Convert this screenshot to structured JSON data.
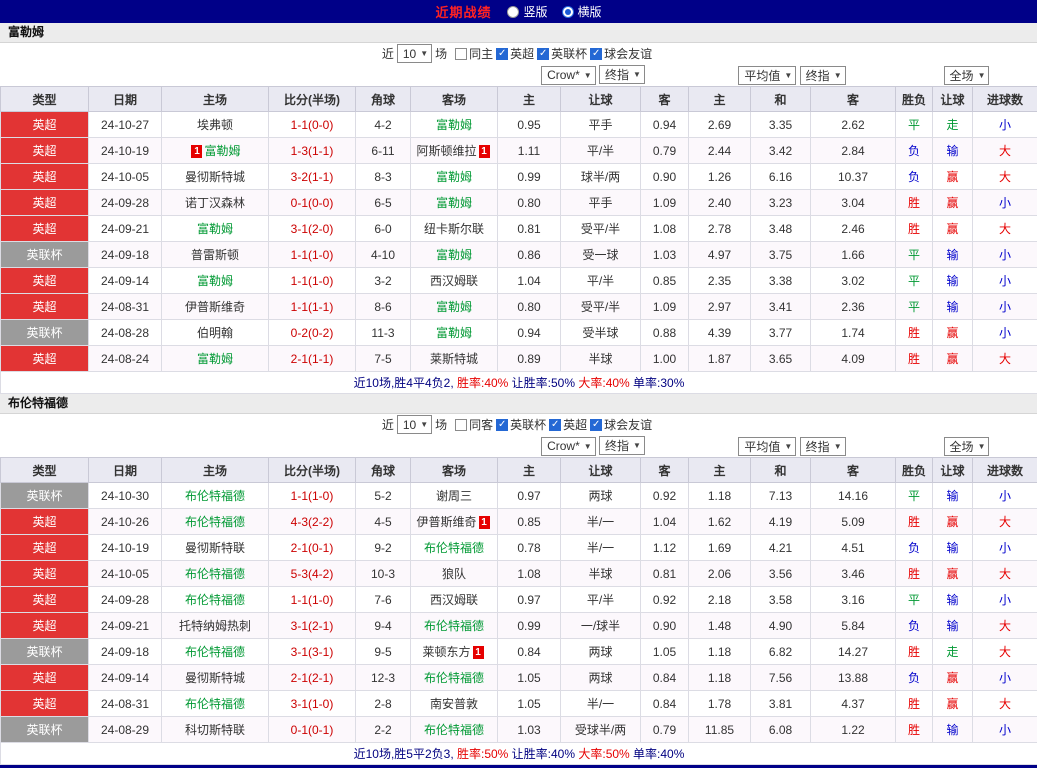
{
  "top_bar": {
    "title": "近期战绩",
    "radios": [
      {
        "label": "竖版",
        "checked": false
      },
      {
        "label": "横版",
        "checked": true
      }
    ]
  },
  "colors": {
    "navy": "#000088",
    "league_red": "#e23434",
    "league_gray": "#9b9b9b",
    "team_green": "#009933",
    "score_red": "#cc0000",
    "win_red": "#e60000",
    "draw_green": "#009933",
    "lose_blue": "#0000cc"
  },
  "sections": [
    {
      "team": "富勒姆",
      "filter": {
        "near_label": "近",
        "count": "10",
        "games_label": "场",
        "checkboxes": [
          {
            "label": "同主",
            "checked": false
          },
          {
            "label": "英超",
            "checked": true
          },
          {
            "label": "英联杯",
            "checked": true
          },
          {
            "label": "球会友谊",
            "checked": true
          }
        ]
      },
      "controls": {
        "odds_company": "Crow*",
        "odds_final": "终指",
        "average": "平均值",
        "average_final": "终指",
        "scope": "全场"
      },
      "headers": [
        "类型",
        "日期",
        "主场",
        "比分(半场)",
        "角球",
        "客场",
        "主",
        "让球",
        "客",
        "主",
        "和",
        "客",
        "胜负",
        "让球",
        "进球数"
      ],
      "rows": [
        {
          "league": "英超",
          "league_color": "red",
          "date": "24-10-27",
          "home": "埃弗顿",
          "home_is_subject": false,
          "home_card": "",
          "score": "1-1(0-0)",
          "corners": "4-2",
          "away": "富勒姆",
          "away_is_subject": true,
          "away_card": "",
          "odds_home": "0.95",
          "handicap": "平手",
          "odds_away": "0.94",
          "avg_home": "2.69",
          "avg_draw": "3.35",
          "avg_away": "2.62",
          "result": "平",
          "result_color": "green",
          "handicap_result": "走",
          "handicap_result_color": "green",
          "goals": "小",
          "goals_color": "blue"
        },
        {
          "league": "英超",
          "league_color": "red",
          "date": "24-10-19",
          "home": "富勒姆",
          "home_is_subject": true,
          "home_card": "before",
          "score": "1-3(1-1)",
          "corners": "6-11",
          "away": "阿斯顿维拉",
          "away_is_subject": false,
          "away_card": "after",
          "odds_home": "1.11",
          "handicap": "平/半",
          "odds_away": "0.79",
          "avg_home": "2.44",
          "avg_draw": "3.42",
          "avg_away": "2.84",
          "result": "负",
          "result_color": "blue",
          "handicap_result": "输",
          "handicap_result_color": "blue",
          "goals": "大",
          "goals_color": "red"
        },
        {
          "league": "英超",
          "league_color": "red",
          "date": "24-10-05",
          "home": "曼彻斯特城",
          "home_is_subject": false,
          "home_card": "",
          "score": "3-2(1-1)",
          "corners": "8-3",
          "away": "富勒姆",
          "away_is_subject": true,
          "away_card": "",
          "odds_home": "0.99",
          "handicap": "球半/两",
          "odds_away": "0.90",
          "avg_home": "1.26",
          "avg_draw": "6.16",
          "avg_away": "10.37",
          "result": "负",
          "result_color": "blue",
          "handicap_result": "赢",
          "handicap_result_color": "red",
          "goals": "大",
          "goals_color": "red"
        },
        {
          "league": "英超",
          "league_color": "red",
          "date": "24-09-28",
          "home": "诺丁汉森林",
          "home_is_subject": false,
          "home_card": "",
          "score": "0-1(0-0)",
          "corners": "6-5",
          "away": "富勒姆",
          "away_is_subject": true,
          "away_card": "",
          "odds_home": "0.80",
          "handicap": "平手",
          "odds_away": "1.09",
          "avg_home": "2.40",
          "avg_draw": "3.23",
          "avg_away": "3.04",
          "result": "胜",
          "result_color": "red",
          "handicap_result": "赢",
          "handicap_result_color": "red",
          "goals": "小",
          "goals_color": "blue"
        },
        {
          "league": "英超",
          "league_color": "red",
          "date": "24-09-21",
          "home": "富勒姆",
          "home_is_subject": true,
          "home_card": "",
          "score": "3-1(2-0)",
          "corners": "6-0",
          "away": "纽卡斯尔联",
          "away_is_subject": false,
          "away_card": "",
          "odds_home": "0.81",
          "handicap": "受平/半",
          "odds_away": "1.08",
          "avg_home": "2.78",
          "avg_draw": "3.48",
          "avg_away": "2.46",
          "result": "胜",
          "result_color": "red",
          "handicap_result": "赢",
          "handicap_result_color": "red",
          "goals": "大",
          "goals_color": "red"
        },
        {
          "league": "英联杯",
          "league_color": "gray",
          "date": "24-09-18",
          "home": "普雷斯顿",
          "home_is_subject": false,
          "home_card": "",
          "score": "1-1(1-0)",
          "corners": "4-10",
          "away": "富勒姆",
          "away_is_subject": true,
          "away_card": "",
          "odds_home": "0.86",
          "handicap": "受一球",
          "odds_away": "1.03",
          "avg_home": "4.97",
          "avg_draw": "3.75",
          "avg_away": "1.66",
          "result": "平",
          "result_color": "green",
          "handicap_result": "输",
          "handicap_result_color": "blue",
          "goals": "小",
          "goals_color": "blue"
        },
        {
          "league": "英超",
          "league_color": "red",
          "date": "24-09-14",
          "home": "富勒姆",
          "home_is_subject": true,
          "home_card": "",
          "score": "1-1(1-0)",
          "corners": "3-2",
          "away": "西汉姆联",
          "away_is_subject": false,
          "away_card": "",
          "odds_home": "1.04",
          "handicap": "平/半",
          "odds_away": "0.85",
          "avg_home": "2.35",
          "avg_draw": "3.38",
          "avg_away": "3.02",
          "result": "平",
          "result_color": "green",
          "handicap_result": "输",
          "handicap_result_color": "blue",
          "goals": "小",
          "goals_color": "blue"
        },
        {
          "league": "英超",
          "league_color": "red",
          "date": "24-08-31",
          "home": "伊普斯维奇",
          "home_is_subject": false,
          "home_card": "",
          "score": "1-1(1-1)",
          "corners": "8-6",
          "away": "富勒姆",
          "away_is_subject": true,
          "away_card": "",
          "odds_home": "0.80",
          "handicap": "受平/半",
          "odds_away": "1.09",
          "avg_home": "2.97",
          "avg_draw": "3.41",
          "avg_away": "2.36",
          "result": "平",
          "result_color": "green",
          "handicap_result": "输",
          "handicap_result_color": "blue",
          "goals": "小",
          "goals_color": "blue"
        },
        {
          "league": "英联杯",
          "league_color": "gray",
          "date": "24-08-28",
          "home": "伯明翰",
          "home_is_subject": false,
          "home_card": "",
          "score": "0-2(0-2)",
          "corners": "11-3",
          "away": "富勒姆",
          "away_is_subject": true,
          "away_card": "",
          "odds_home": "0.94",
          "handicap": "受半球",
          "odds_away": "0.88",
          "avg_home": "4.39",
          "avg_draw": "3.77",
          "avg_away": "1.74",
          "result": "胜",
          "result_color": "red",
          "handicap_result": "赢",
          "handicap_result_color": "red",
          "goals": "小",
          "goals_color": "blue"
        },
        {
          "league": "英超",
          "league_color": "red",
          "date": "24-08-24",
          "home": "富勒姆",
          "home_is_subject": true,
          "home_card": "",
          "score": "2-1(1-1)",
          "corners": "7-5",
          "away": "莱斯特城",
          "away_is_subject": false,
          "away_card": "",
          "odds_home": "0.89",
          "handicap": "半球",
          "odds_away": "1.00",
          "avg_home": "1.87",
          "avg_draw": "3.65",
          "avg_away": "4.09",
          "result": "胜",
          "result_color": "red",
          "handicap_result": "赢",
          "handicap_result_color": "red",
          "goals": "大",
          "goals_color": "red"
        }
      ],
      "summary": [
        {
          "text": "近10场,胜4平4负2, ",
          "color": "navy"
        },
        {
          "text": "胜率:40%",
          "color": "red"
        },
        {
          "text": " 让胜率:50%",
          "color": "navy"
        },
        {
          "text": " 大率:40%",
          "color": "red"
        },
        {
          "text": " 单率:30%",
          "color": "navy"
        }
      ]
    },
    {
      "team": "布伦特福德",
      "filter": {
        "near_label": "近",
        "count": "10",
        "games_label": "场",
        "checkboxes": [
          {
            "label": "同客",
            "checked": false
          },
          {
            "label": "英联杯",
            "checked": true
          },
          {
            "label": "英超",
            "checked": true
          },
          {
            "label": "球会友谊",
            "checked": true
          }
        ]
      },
      "controls": {
        "odds_company": "Crow*",
        "odds_final": "终指",
        "average": "平均值",
        "average_final": "终指",
        "scope": "全场"
      },
      "headers": [
        "类型",
        "日期",
        "主场",
        "比分(半场)",
        "角球",
        "客场",
        "主",
        "让球",
        "客",
        "主",
        "和",
        "客",
        "胜负",
        "让球",
        "进球数"
      ],
      "rows": [
        {
          "league": "英联杯",
          "league_color": "gray",
          "date": "24-10-30",
          "home": "布伦特福德",
          "home_is_subject": true,
          "home_card": "",
          "score": "1-1(1-0)",
          "corners": "5-2",
          "away": "谢周三",
          "away_is_subject": false,
          "away_card": "",
          "odds_home": "0.97",
          "handicap": "两球",
          "odds_away": "0.92",
          "avg_home": "1.18",
          "avg_draw": "7.13",
          "avg_away": "14.16",
          "result": "平",
          "result_color": "green",
          "handicap_result": "输",
          "handicap_result_color": "blue",
          "goals": "小",
          "goals_color": "blue"
        },
        {
          "league": "英超",
          "league_color": "red",
          "date": "24-10-26",
          "home": "布伦特福德",
          "home_is_subject": true,
          "home_card": "",
          "score": "4-3(2-2)",
          "corners": "4-5",
          "away": "伊普斯维奇",
          "away_is_subject": false,
          "away_card": "after",
          "odds_home": "0.85",
          "handicap": "半/一",
          "odds_away": "1.04",
          "avg_home": "1.62",
          "avg_draw": "4.19",
          "avg_away": "5.09",
          "result": "胜",
          "result_color": "red",
          "handicap_result": "赢",
          "handicap_result_color": "red",
          "goals": "大",
          "goals_color": "red"
        },
        {
          "league": "英超",
          "league_color": "red",
          "date": "24-10-19",
          "home": "曼彻斯特联",
          "home_is_subject": false,
          "home_card": "",
          "score": "2-1(0-1)",
          "corners": "9-2",
          "away": "布伦特福德",
          "away_is_subject": true,
          "away_card": "",
          "odds_home": "0.78",
          "handicap": "半/一",
          "odds_away": "1.12",
          "avg_home": "1.69",
          "avg_draw": "4.21",
          "avg_away": "4.51",
          "result": "负",
          "result_color": "blue",
          "handicap_result": "输",
          "handicap_result_color": "blue",
          "goals": "小",
          "goals_color": "blue"
        },
        {
          "league": "英超",
          "league_color": "red",
          "date": "24-10-05",
          "home": "布伦特福德",
          "home_is_subject": true,
          "home_card": "",
          "score": "5-3(4-2)",
          "corners": "10-3",
          "away": "狼队",
          "away_is_subject": false,
          "away_card": "",
          "odds_home": "1.08",
          "handicap": "半球",
          "odds_away": "0.81",
          "avg_home": "2.06",
          "avg_draw": "3.56",
          "avg_away": "3.46",
          "result": "胜",
          "result_color": "red",
          "handicap_result": "赢",
          "handicap_result_color": "red",
          "goals": "大",
          "goals_color": "red"
        },
        {
          "league": "英超",
          "league_color": "red",
          "date": "24-09-28",
          "home": "布伦特福德",
          "home_is_subject": true,
          "home_card": "",
          "score": "1-1(1-0)",
          "corners": "7-6",
          "away": "西汉姆联",
          "away_is_subject": false,
          "away_card": "",
          "odds_home": "0.97",
          "handicap": "平/半",
          "odds_away": "0.92",
          "avg_home": "2.18",
          "avg_draw": "3.58",
          "avg_away": "3.16",
          "result": "平",
          "result_color": "green",
          "handicap_result": "输",
          "handicap_result_color": "blue",
          "goals": "小",
          "goals_color": "blue"
        },
        {
          "league": "英超",
          "league_color": "red",
          "date": "24-09-21",
          "home": "托特纳姆热刺",
          "home_is_subject": false,
          "home_card": "",
          "score": "3-1(2-1)",
          "corners": "9-4",
          "away": "布伦特福德",
          "away_is_subject": true,
          "away_card": "",
          "odds_home": "0.99",
          "handicap": "一/球半",
          "odds_away": "0.90",
          "avg_home": "1.48",
          "avg_draw": "4.90",
          "avg_away": "5.84",
          "result": "负",
          "result_color": "blue",
          "handicap_result": "输",
          "handicap_result_color": "blue",
          "goals": "大",
          "goals_color": "red"
        },
        {
          "league": "英联杯",
          "league_color": "gray",
          "date": "24-09-18",
          "home": "布伦特福德",
          "home_is_subject": true,
          "home_card": "",
          "score": "3-1(3-1)",
          "corners": "9-5",
          "away": "莱顿东方",
          "away_is_subject": false,
          "away_card": "after",
          "odds_home": "0.84",
          "handicap": "两球",
          "odds_away": "1.05",
          "avg_home": "1.18",
          "avg_draw": "6.82",
          "avg_away": "14.27",
          "result": "胜",
          "result_color": "red",
          "handicap_result": "走",
          "handicap_result_color": "green",
          "goals": "大",
          "goals_color": "red"
        },
        {
          "league": "英超",
          "league_color": "red",
          "date": "24-09-14",
          "home": "曼彻斯特城",
          "home_is_subject": false,
          "home_card": "",
          "score": "2-1(2-1)",
          "corners": "12-3",
          "away": "布伦特福德",
          "away_is_subject": true,
          "away_card": "",
          "odds_home": "1.05",
          "handicap": "两球",
          "odds_away": "0.84",
          "avg_home": "1.18",
          "avg_draw": "7.56",
          "avg_away": "13.88",
          "result": "负",
          "result_color": "blue",
          "handicap_result": "赢",
          "handicap_result_color": "red",
          "goals": "小",
          "goals_color": "blue"
        },
        {
          "league": "英超",
          "league_color": "red",
          "date": "24-08-31",
          "home": "布伦特福德",
          "home_is_subject": true,
          "home_card": "",
          "score": "3-1(1-0)",
          "corners": "2-8",
          "away": "南安普敦",
          "away_is_subject": false,
          "away_card": "",
          "odds_home": "1.05",
          "handicap": "半/一",
          "odds_away": "0.84",
          "avg_home": "1.78",
          "avg_draw": "3.81",
          "avg_away": "4.37",
          "result": "胜",
          "result_color": "red",
          "handicap_result": "赢",
          "handicap_result_color": "red",
          "goals": "大",
          "goals_color": "red"
        },
        {
          "league": "英联杯",
          "league_color": "gray",
          "date": "24-08-29",
          "home": "科切斯特联",
          "home_is_subject": false,
          "home_card": "",
          "score": "0-1(0-1)",
          "corners": "2-2",
          "away": "布伦特福德",
          "away_is_subject": true,
          "away_card": "",
          "odds_home": "1.03",
          "handicap": "受球半/两",
          "odds_away": "0.79",
          "avg_home": "11.85",
          "avg_draw": "6.08",
          "avg_away": "1.22",
          "result": "胜",
          "result_color": "red",
          "handicap_result": "输",
          "handicap_result_color": "blue",
          "goals": "小",
          "goals_color": "blue"
        }
      ],
      "summary": [
        {
          "text": "近10场,胜5平2负3, ",
          "color": "navy"
        },
        {
          "text": "胜率:50%",
          "color": "red"
        },
        {
          "text": " 让胜率:40%",
          "color": "navy"
        },
        {
          "text": " 大率:50%",
          "color": "red"
        },
        {
          "text": " 单率:40%",
          "color": "navy"
        }
      ]
    }
  ]
}
